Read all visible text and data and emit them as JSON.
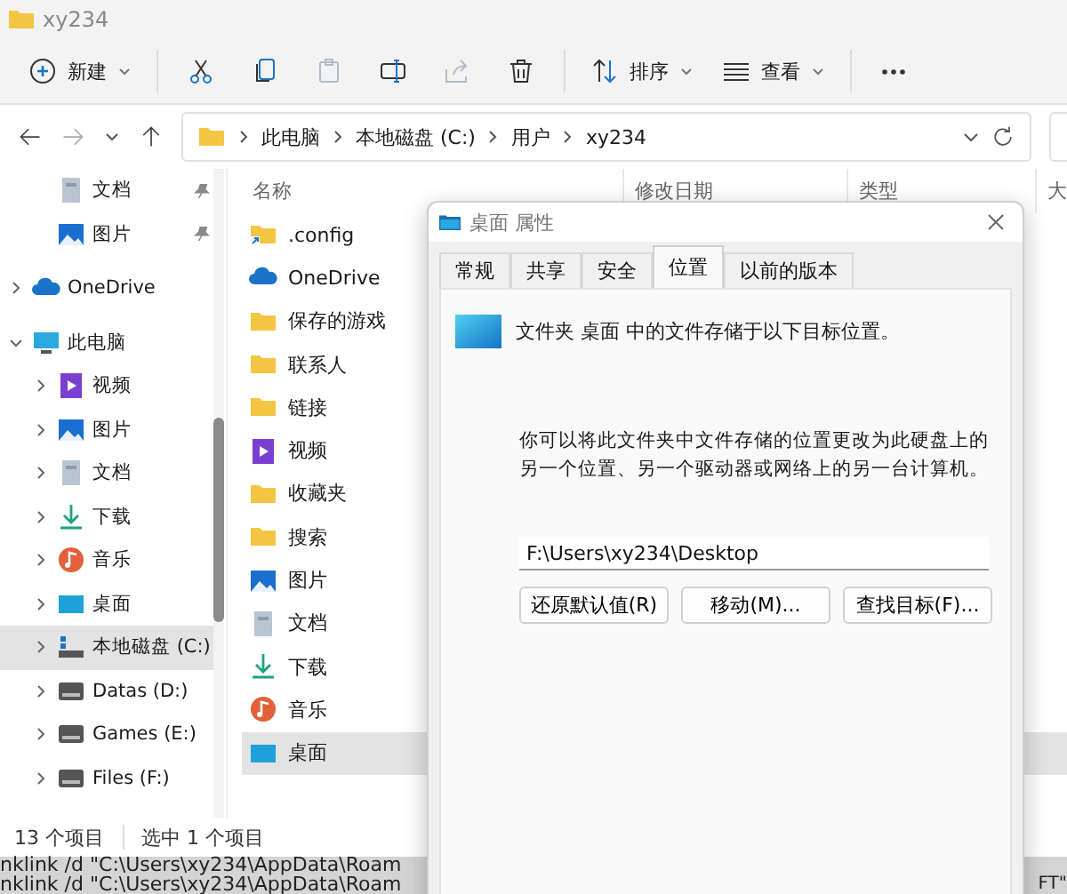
{
  "window": {
    "title": "xy234"
  },
  "toolbar": {
    "items": [
      {
        "kind": "new",
        "label": "新建",
        "disabled": false
      },
      {
        "kind": "cut",
        "disabled": false
      },
      {
        "kind": "copy",
        "disabled": false
      },
      {
        "kind": "paste",
        "disabled": true
      },
      {
        "kind": "rename",
        "disabled": false
      },
      {
        "kind": "share",
        "disabled": true
      },
      {
        "kind": "delete",
        "disabled": false
      },
      {
        "kind": "sort",
        "label": "排序",
        "disabled": false
      },
      {
        "kind": "view",
        "label": "查看",
        "disabled": false
      },
      {
        "kind": "more",
        "disabled": false
      }
    ]
  },
  "address_bar": {
    "forward_disabled": true,
    "breadcrumbs": [
      "此电脑",
      "本地磁盘 (C:)",
      "用户",
      "xy234"
    ]
  },
  "sidebar": {
    "items": [
      {
        "label": "文档",
        "kind": "document",
        "pinned": true,
        "selected": false
      },
      {
        "label": "图片",
        "kind": "picture",
        "pinned": true,
        "selected": false
      },
      {
        "label": "OneDrive",
        "kind": "cloud",
        "expanded": false,
        "selected": false
      },
      {
        "label": "此电脑",
        "kind": "monitor",
        "expanded": true,
        "selected": false,
        "children": [
          {
            "label": "视频",
            "kind": "video",
            "expanded": false,
            "selected": false
          },
          {
            "label": "图片",
            "kind": "picture",
            "expanded": false,
            "selected": false
          },
          {
            "label": "文档",
            "kind": "document",
            "expanded": false,
            "selected": false
          },
          {
            "label": "下载",
            "kind": "download",
            "expanded": false,
            "selected": false
          },
          {
            "label": "音乐",
            "kind": "music",
            "expanded": false,
            "selected": false
          },
          {
            "label": "桌面",
            "kind": "desktop",
            "expanded": false,
            "selected": false
          },
          {
            "label": "本地磁盘 (C:)",
            "kind": "system-drive",
            "expanded": false,
            "selected": true
          },
          {
            "label": "Datas (D:)",
            "kind": "drive",
            "expanded": false,
            "selected": false
          },
          {
            "label": "Games (E:)",
            "kind": "drive",
            "expanded": false,
            "selected": false
          },
          {
            "label": "Files (F:)",
            "kind": "drive",
            "expanded": false,
            "selected": false
          }
        ]
      }
    ]
  },
  "files": {
    "columns": [
      "名称",
      "修改日期",
      "类型",
      "大"
    ],
    "items": [
      {
        "name": ".config",
        "kind": "folder-link",
        "selected": false
      },
      {
        "name": "OneDrive",
        "kind": "cloud",
        "selected": false
      },
      {
        "name": "保存的游戏",
        "kind": "folder",
        "selected": false
      },
      {
        "name": "联系人",
        "kind": "folder",
        "selected": false
      },
      {
        "name": "链接",
        "kind": "folder",
        "selected": false
      },
      {
        "name": "视频",
        "kind": "video",
        "selected": false
      },
      {
        "name": "收藏夹",
        "kind": "folder",
        "selected": false
      },
      {
        "name": "搜索",
        "kind": "folder",
        "selected": false
      },
      {
        "name": "图片",
        "kind": "picture",
        "selected": false
      },
      {
        "name": "文档",
        "kind": "document",
        "selected": false
      },
      {
        "name": "下载",
        "kind": "download",
        "selected": false
      },
      {
        "name": "音乐",
        "kind": "music",
        "selected": false
      },
      {
        "name": "桌面",
        "kind": "desktop",
        "selected": true
      }
    ]
  },
  "status_bar": {
    "count": "13 个项目",
    "selection": "选中 1 个项目"
  },
  "background_terminal": {
    "lines": [
      "nklink /d \"C:\\Users\\xy234\\AppData\\Roam",
      "nklink /d \"C:\\Users\\xy234\\AppData\\Roam"
    ],
    "right_text": "FT\""
  },
  "dialog": {
    "title": "桌面 属性",
    "tabs": [
      {
        "label": "常规",
        "selected": false
      },
      {
        "label": "共享",
        "selected": false
      },
      {
        "label": "安全",
        "selected": false
      },
      {
        "label": "位置",
        "selected": true
      },
      {
        "label": "以前的版本",
        "selected": false
      }
    ],
    "intro": "文件夹 桌面 中的文件存储于以下目标位置。",
    "description": "你可以将此文件夹中文件存储的位置更改为此硬盘上的另一个位置、另一个驱动器或网络上的另一台计算机。",
    "path": "F:\\Users\\xy234\\Desktop",
    "buttons": [
      "还原默认值(R)",
      "移动(M)...",
      "查找目标(F)..."
    ]
  }
}
